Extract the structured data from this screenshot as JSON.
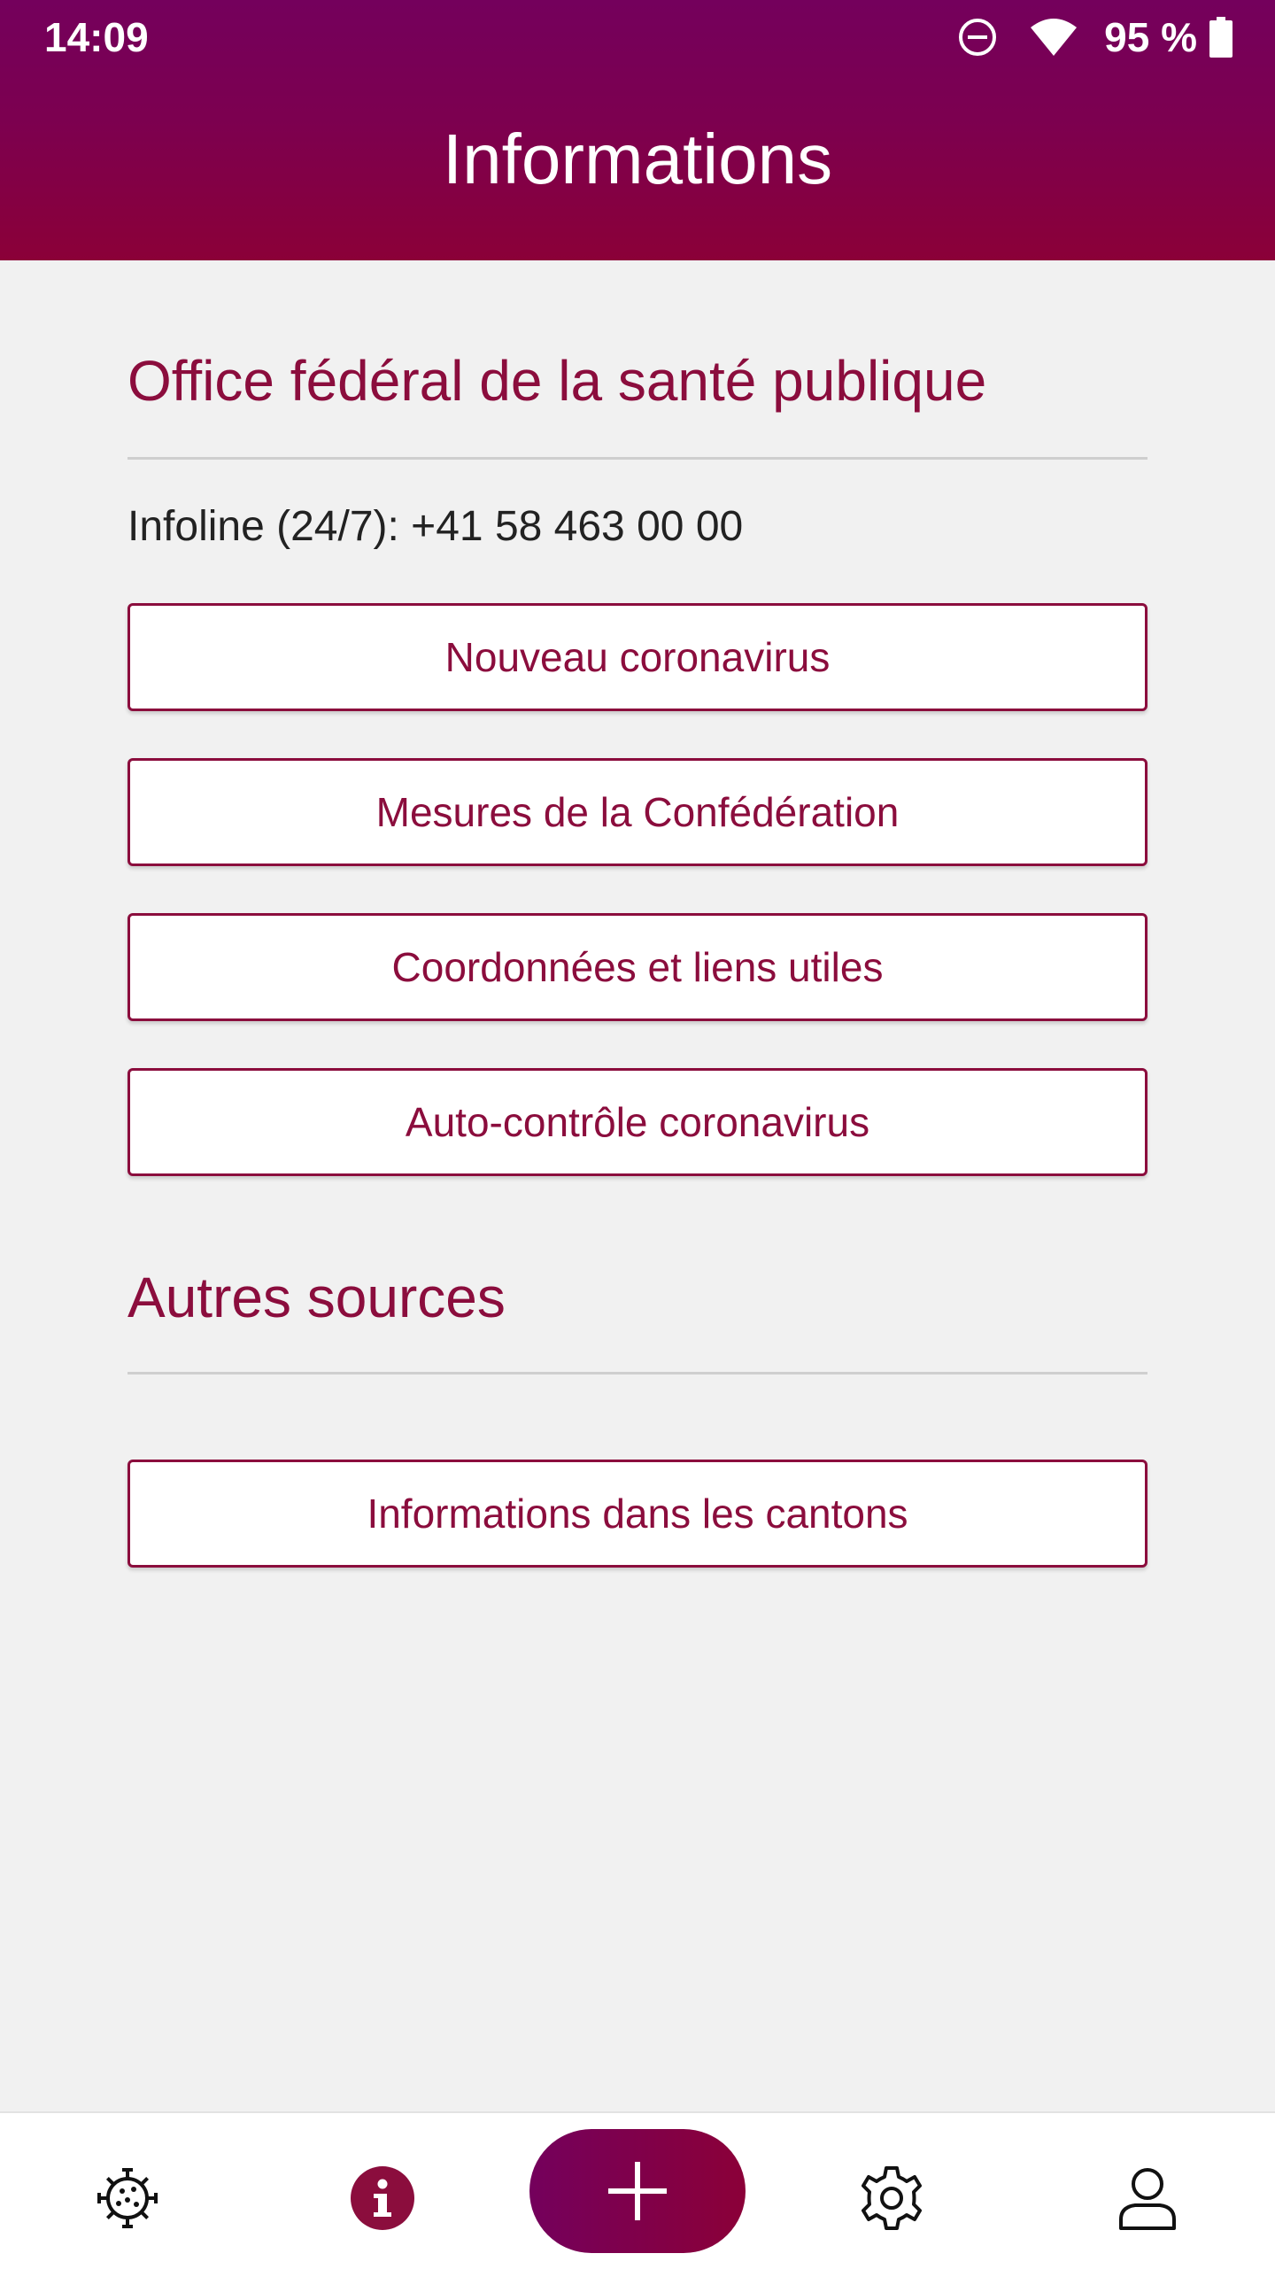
{
  "status_bar": {
    "time": "14:09",
    "battery": "95 %",
    "icons": [
      "do-not-disturb-icon",
      "wifi-icon",
      "battery-icon"
    ]
  },
  "header": {
    "title": "Informations"
  },
  "section_federal": {
    "title": "Office fédéral de la santé publique",
    "infoline": "Infoline (24/7): +41 58 463 00 00",
    "buttons": [
      {
        "label": "Nouveau coronavirus"
      },
      {
        "label": "Mesures de la Confédération"
      },
      {
        "label": "Coordonnées et liens utiles"
      },
      {
        "label": "Auto-contrôle coronavirus"
      }
    ]
  },
  "section_other": {
    "title": "Autres sources",
    "buttons": [
      {
        "label": "Informations dans les cantons"
      }
    ]
  },
  "bottom_nav": {
    "items": [
      {
        "icon": "virus-icon",
        "active": false
      },
      {
        "icon": "info-icon",
        "active": true
      },
      {
        "icon": "plus-icon",
        "active": false
      },
      {
        "icon": "gear-icon",
        "active": false
      },
      {
        "icon": "person-icon",
        "active": false
      }
    ]
  },
  "colors": {
    "brand_primary": "#8b0d3d",
    "header_gradient_top": "#74005c",
    "header_gradient_bottom": "#8b0038",
    "background": "#f1f1f1"
  }
}
